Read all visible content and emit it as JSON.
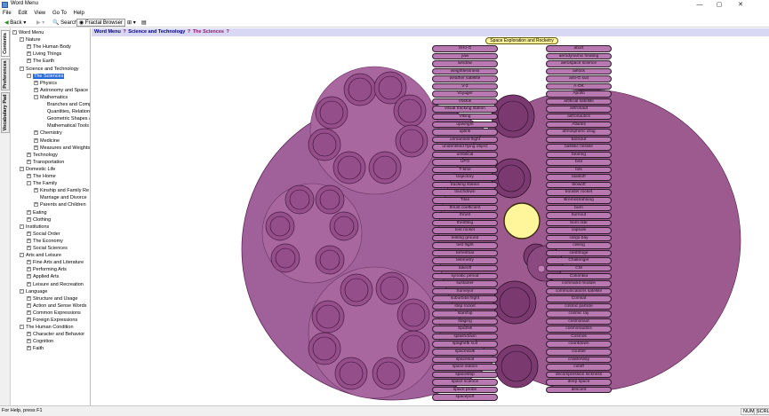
{
  "window": {
    "title": "Word Menu",
    "minimize": "—",
    "maximize": "▢",
    "close": "✕"
  },
  "menu": [
    "File",
    "Edit",
    "View",
    "Go To",
    "Help"
  ],
  "toolbar": {
    "back": "Back",
    "forward": "",
    "search": "Search",
    "fractal": "Fractal Browser"
  },
  "side_tabs": [
    "Contents",
    "Preferences",
    "Vocabulary Pad"
  ],
  "tree": [
    {
      "label": "Word Menu",
      "level": 0,
      "exp": "-"
    },
    {
      "label": "Nature",
      "level": 1,
      "exp": "-"
    },
    {
      "label": "The Human Body",
      "level": 2,
      "exp": "+"
    },
    {
      "label": "Living Things",
      "level": 2,
      "exp": "+"
    },
    {
      "label": "The Earth",
      "level": 2,
      "exp": "+"
    },
    {
      "label": "Science and Technology",
      "level": 1,
      "exp": "-"
    },
    {
      "label": "The Sciences",
      "level": 2,
      "exp": "-",
      "selected": true
    },
    {
      "label": "Physics",
      "level": 3,
      "exp": "+"
    },
    {
      "label": "Astronomy and Space S",
      "level": 3,
      "exp": "+"
    },
    {
      "label": "Mathematics",
      "level": 3,
      "exp": "-"
    },
    {
      "label": "Branches and Comp",
      "level": 4,
      "exp": ""
    },
    {
      "label": "Quantities, Relation",
      "level": 4,
      "exp": ""
    },
    {
      "label": "Geometric Shapes a",
      "level": 4,
      "exp": ""
    },
    {
      "label": "Mathematical Tools",
      "level": 4,
      "exp": ""
    },
    {
      "label": "Chemistry",
      "level": 3,
      "exp": "+"
    },
    {
      "label": "Medicine",
      "level": 3,
      "exp": "+"
    },
    {
      "label": "Measures and Weights",
      "level": 3,
      "exp": "+"
    },
    {
      "label": "Technology",
      "level": 2,
      "exp": "+"
    },
    {
      "label": "Transportation",
      "level": 2,
      "exp": "+"
    },
    {
      "label": "Domestic Life",
      "level": 1,
      "exp": "-"
    },
    {
      "label": "The Home",
      "level": 2,
      "exp": "+"
    },
    {
      "label": "The Family",
      "level": 2,
      "exp": "-"
    },
    {
      "label": "Kinship and Family Re",
      "level": 3,
      "exp": "+"
    },
    {
      "label": "Marriage and Divorce",
      "level": 3,
      "exp": ""
    },
    {
      "label": "Parents and Children",
      "level": 3,
      "exp": "+"
    },
    {
      "label": "Eating",
      "level": 2,
      "exp": "+"
    },
    {
      "label": "Clothing",
      "level": 2,
      "exp": "+"
    },
    {
      "label": "Institutions",
      "level": 1,
      "exp": "-"
    },
    {
      "label": "Social Order",
      "level": 2,
      "exp": "+"
    },
    {
      "label": "The Economy",
      "level": 2,
      "exp": "+"
    },
    {
      "label": "Social Sciences",
      "level": 2,
      "exp": "+"
    },
    {
      "label": "Arts and Leisure",
      "level": 1,
      "exp": "-"
    },
    {
      "label": "Fine Arts and Literature",
      "level": 2,
      "exp": "+"
    },
    {
      "label": "Performing Arts",
      "level": 2,
      "exp": "+"
    },
    {
      "label": "Applied Arts",
      "level": 2,
      "exp": "+"
    },
    {
      "label": "Leisure and Recreation",
      "level": 2,
      "exp": "+"
    },
    {
      "label": "Language",
      "level": 1,
      "exp": "-"
    },
    {
      "label": "Structure and Usage",
      "level": 2,
      "exp": "+"
    },
    {
      "label": "Action and Sense Words",
      "level": 2,
      "exp": "+"
    },
    {
      "label": "Common Expressions",
      "level": 2,
      "exp": "+"
    },
    {
      "label": "Foreign Expressions",
      "level": 2,
      "exp": "+"
    },
    {
      "label": "The Human Condition",
      "level": 1,
      "exp": "-"
    },
    {
      "label": "Character and Behavior",
      "level": 2,
      "exp": "+"
    },
    {
      "label": "Cognition",
      "level": 2,
      "exp": "+"
    },
    {
      "label": "Faith",
      "level": 2,
      "exp": "+"
    }
  ],
  "breadcrumb": [
    "Word Menu",
    "Science and Technology",
    "The Sciences"
  ],
  "breadcrumb_sep": "?",
  "tooltip": "Space Exploration and Rocketry",
  "words_left": [
    "zero-G",
    "yaw",
    "window",
    "weightlessness",
    "weather satellite",
    "V-2",
    "Voyager",
    "Vostok",
    "visual tracking station",
    "Viking",
    "upweight",
    "uplink",
    "unmanned flight",
    "unidentified flying object",
    "umbilical",
    "UFO",
    "T-time",
    "trajectory",
    "tracking station",
    "touchdown",
    "Titan",
    "thrust coefficient",
    "thrust",
    "throttling",
    "test rocket",
    "testing ground",
    "test flight",
    "terrestrial",
    "telemetry",
    "takeoff",
    "synodic period",
    "sustainer",
    "Surveyor",
    "suborbital flight",
    "step rocket",
    "starship",
    "staging",
    "Sputnik",
    "splashdown",
    "spaghetti suit",
    "spacewalk",
    "spacesuit",
    "space station",
    "spaceship",
    "space science",
    "space probe",
    "spaceport"
  ],
  "words_right": [
    "abort",
    "aerodynamic heating",
    "aerospace science",
    "airlock",
    "anti-G suit",
    "A-OK",
    "Apollo",
    "artificial satellite",
    "astronaut",
    "astronautics",
    "Atlantis",
    "atmospheric drag",
    "backout",
    "ballistic missile",
    "bearing",
    "bird",
    "bits",
    "blastoff",
    "blowoff",
    "booster rocket",
    "Bremsstrahlung",
    "burn",
    "burnout",
    "burn rate",
    "capsule",
    "cargo bay",
    "ceiling",
    "centrifuge",
    "Challenger",
    "CM",
    "Columbia",
    "command module",
    "communications satellite",
    "Comsat",
    "cosmic particle",
    "cosmic ray",
    "cosmonaut",
    "cosmonautics",
    "Cosmos",
    "countdown",
    "counter",
    "crawlerway",
    "cutoff",
    "decompression sickness",
    "deep space",
    "descent"
  ],
  "status": {
    "text": "For Help, press F1",
    "num": "NUM",
    "scrl": "SCRL"
  },
  "colors": {
    "disk": "#9c5a8e",
    "sphere": "#b070a5",
    "button": "#b878b0",
    "highlight": "#fff59a"
  }
}
